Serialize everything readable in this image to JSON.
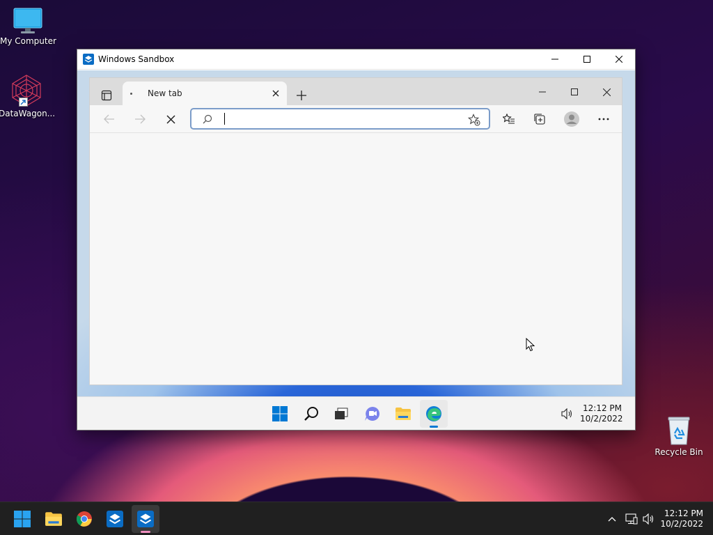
{
  "desktop": {
    "icons": [
      {
        "label": "My Computer",
        "icon": "monitor-icon"
      },
      {
        "label": "DataWagon...",
        "icon": "datawagon-icon"
      },
      {
        "label": "Recycle Bin",
        "icon": "recycle-bin-icon"
      }
    ],
    "partial_label": "R"
  },
  "sandbox": {
    "title": "Windows Sandbox",
    "controls": [
      "minimize-icon",
      "maximize-icon",
      "close-icon"
    ],
    "taskbar": {
      "apps": [
        "windows-start-icon",
        "search-icon",
        "task-view-icon",
        "teams-chat-icon",
        "file-explorer-icon",
        "edge-icon"
      ],
      "time": "12:12 PM",
      "date": "10/2/2022"
    }
  },
  "browser": {
    "tab_title": "New tab",
    "address_value": "",
    "address_placeholder": ""
  },
  "taskbar": {
    "apps": [
      "windows-start-icon",
      "file-explorer-icon",
      "chrome-icon",
      "sandbox-icon",
      "sandbox-active-icon"
    ],
    "time": "12:12 PM",
    "date": "10/2/2022"
  },
  "colors": {
    "accent": "#0078d4",
    "taskbar": "#202020",
    "edge_tabbar": "#dcdcdc"
  }
}
